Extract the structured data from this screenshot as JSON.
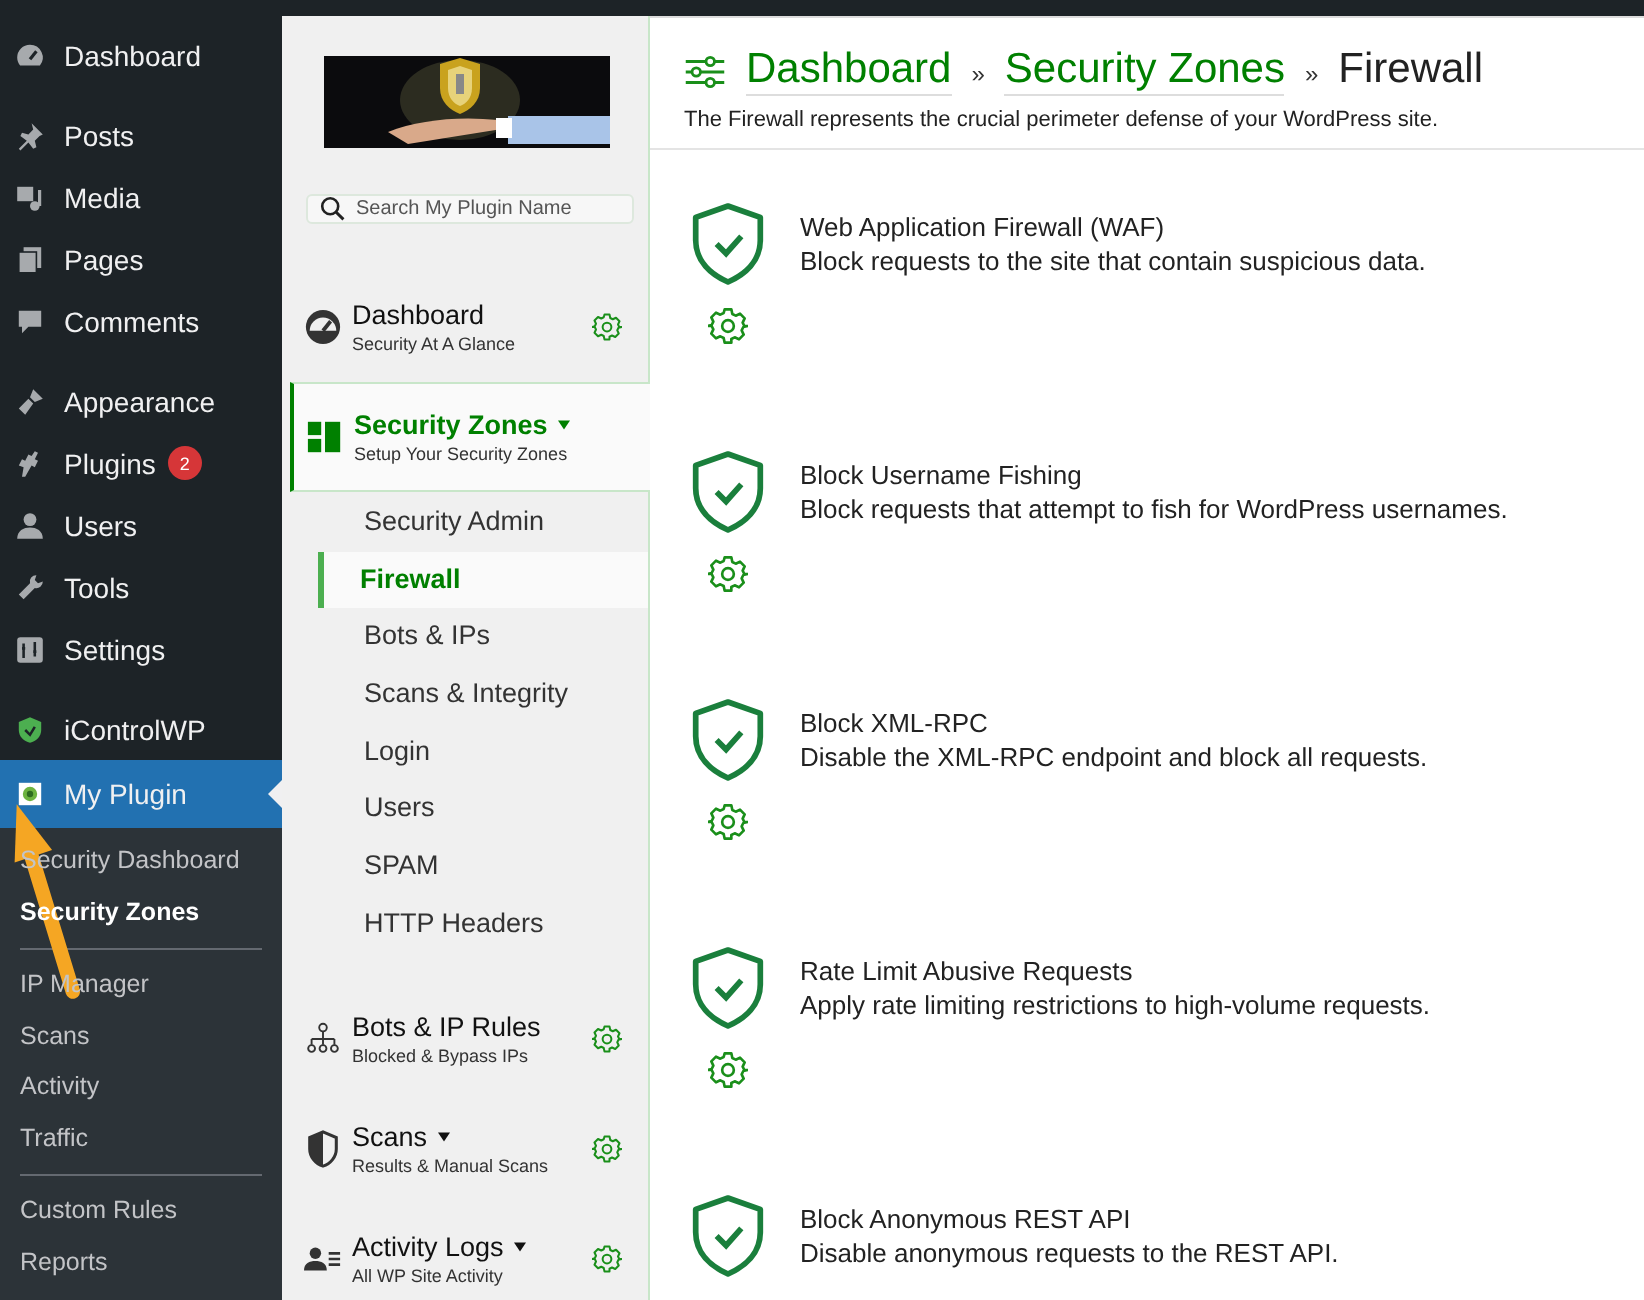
{
  "wp_menu": {
    "groups": [
      [
        {
          "label": "Dashboard",
          "selected": false
        }
      ],
      [
        {
          "label": "Posts",
          "selected": false
        },
        {
          "label": "Media",
          "selected": false
        },
        {
          "label": "Pages",
          "selected": false
        },
        {
          "label": "Comments",
          "selected": false
        }
      ],
      [
        {
          "label": "Appearance",
          "selected": false
        },
        {
          "label": "Plugins",
          "selected": false,
          "badge": "2"
        },
        {
          "label": "Users",
          "selected": false
        },
        {
          "label": "Tools",
          "selected": false
        },
        {
          "label": "Settings",
          "selected": false
        }
      ],
      [
        {
          "label": "iControlWP",
          "selected": false
        },
        {
          "label": "My Plugin",
          "selected": true
        }
      ]
    ],
    "submenu": [
      [
        {
          "label": "Security Dashboard",
          "selected": false
        },
        {
          "label": "Security Zones",
          "selected": true
        }
      ],
      [
        {
          "label": "IP Manager",
          "selected": false
        },
        {
          "label": "Scans",
          "selected": false
        },
        {
          "label": "Activity",
          "selected": false
        },
        {
          "label": "Traffic",
          "selected": false
        }
      ],
      [
        {
          "label": "Custom Rules",
          "selected": false
        },
        {
          "label": "Reports",
          "selected": false
        }
      ]
    ]
  },
  "plugin_nav": {
    "search": {
      "placeholder": "Search My Plugin Name"
    },
    "sections": [
      {
        "title": "Dashboard",
        "subtitle": "Security At A Glance",
        "selected": false,
        "dropdown": false
      },
      {
        "title": "Security Zones",
        "subtitle": "Setup Your Security Zones",
        "selected": true,
        "dropdown": true,
        "children": [
          {
            "label": "Security Admin",
            "selected": false
          },
          {
            "label": "Firewall",
            "selected": true
          },
          {
            "label": "Bots & IPs",
            "selected": false
          },
          {
            "label": "Scans & Integrity",
            "selected": false
          },
          {
            "label": "Login",
            "selected": false
          },
          {
            "label": "Users",
            "selected": false
          },
          {
            "label": "SPAM",
            "selected": false
          },
          {
            "label": "HTTP Headers",
            "selected": false
          }
        ]
      },
      {
        "title": "Bots & IP Rules",
        "subtitle": "Blocked & Bypass IPs",
        "selected": false,
        "dropdown": false
      },
      {
        "title": "Scans",
        "subtitle": "Results & Manual Scans",
        "selected": false,
        "dropdown": true
      },
      {
        "title": "Activity Logs",
        "subtitle": "All WP Site Activity",
        "selected": false,
        "dropdown": true
      }
    ]
  },
  "main": {
    "breadcrumb": [
      {
        "label": "Dashboard",
        "link": true
      },
      {
        "label": "Security Zones",
        "link": true
      },
      {
        "label": "Firewall",
        "link": false
      }
    ],
    "separator": "»",
    "description": "The Firewall represents the crucial perimeter defense of your WordPress site.",
    "features": [
      {
        "title": "Web Application Firewall (WAF)",
        "description": "Block requests to the site that contain suspicious data."
      },
      {
        "title": "Block Username Fishing",
        "description": "Block requests that attempt to fish for WordPress usernames."
      },
      {
        "title": "Block XML-RPC",
        "description": "Disable the XML-RPC endpoint and block all requests."
      },
      {
        "title": "Rate Limit Abusive Requests",
        "description": "Apply rate limiting restrictions to high-volume requests."
      },
      {
        "title": "Block Anonymous REST API",
        "description": "Disable anonymous requests to the REST API."
      }
    ]
  }
}
